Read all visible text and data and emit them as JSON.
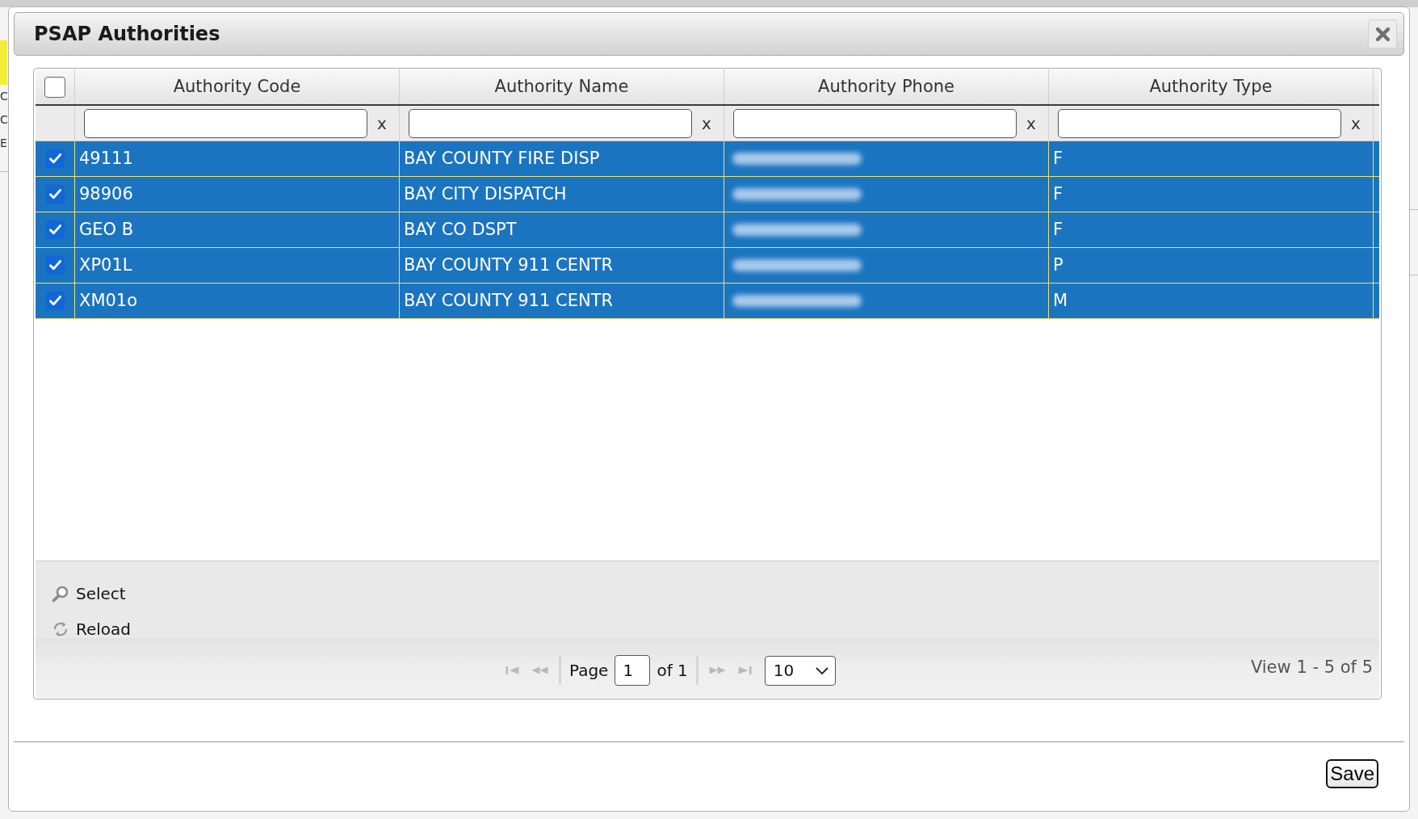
{
  "dialog": {
    "title": "PSAP Authorities"
  },
  "grid": {
    "select_all": {
      "checked": false
    },
    "columns": [
      {
        "label": "Authority Code",
        "filter": {
          "clear": "x"
        }
      },
      {
        "label": "Authority Name",
        "filter": {
          "clear": "x"
        }
      },
      {
        "label": "Authority Phone",
        "filter": {
          "clear": "x"
        }
      },
      {
        "label": "Authority Type",
        "filter": {
          "clear": "x"
        }
      }
    ],
    "rows": [
      {
        "selected": true,
        "checked": true,
        "cells": [
          {
            "kind": "text",
            "text": "49111"
          },
          {
            "kind": "text",
            "text": "BAY COUNTY FIRE DISP"
          },
          {
            "kind": "blurred"
          },
          {
            "kind": "text",
            "text": "F"
          }
        ]
      },
      {
        "selected": true,
        "checked": true,
        "cells": [
          {
            "kind": "text",
            "text": "98906"
          },
          {
            "kind": "text",
            "text": "BAY CITY DISPATCH"
          },
          {
            "kind": "blurred"
          },
          {
            "kind": "text",
            "text": "F"
          }
        ]
      },
      {
        "selected": true,
        "checked": true,
        "cells": [
          {
            "kind": "text",
            "text": "GEO B"
          },
          {
            "kind": "text",
            "text": "BAY CO DSPT"
          },
          {
            "kind": "blurred"
          },
          {
            "kind": "text",
            "text": "F"
          }
        ]
      },
      {
        "selected": true,
        "checked": true,
        "cells": [
          {
            "kind": "text",
            "text": "XP01L"
          },
          {
            "kind": "text",
            "text": "BAY COUNTY 911 CENTR"
          },
          {
            "kind": "blurred"
          },
          {
            "kind": "text",
            "text": "P"
          }
        ]
      },
      {
        "selected": true,
        "checked": true,
        "cells": [
          {
            "kind": "text",
            "text": "XM01o"
          },
          {
            "kind": "text",
            "text": "BAY COUNTY 911 CENTR"
          },
          {
            "kind": "blurred"
          },
          {
            "kind": "text",
            "text": "M"
          }
        ]
      }
    ],
    "toolbar": [
      {
        "kind": "search",
        "label": "Select"
      },
      {
        "kind": "reload",
        "label": "Reload"
      }
    ],
    "pager": {
      "buttons": [
        {
          "kind": "first",
          "disabled": true
        },
        {
          "kind": "prev",
          "disabled": true
        },
        {
          "kind": "next",
          "disabled": true
        },
        {
          "kind": "last",
          "disabled": true
        }
      ],
      "page_label": "Page",
      "page": "1",
      "page_total": "of 1",
      "page_size": "10",
      "summary": "View 1 - 5 of 5"
    }
  },
  "footer": {
    "save_button": "Save"
  },
  "background_page": {
    "fragments": [
      "C",
      "C",
      "E"
    ]
  }
}
